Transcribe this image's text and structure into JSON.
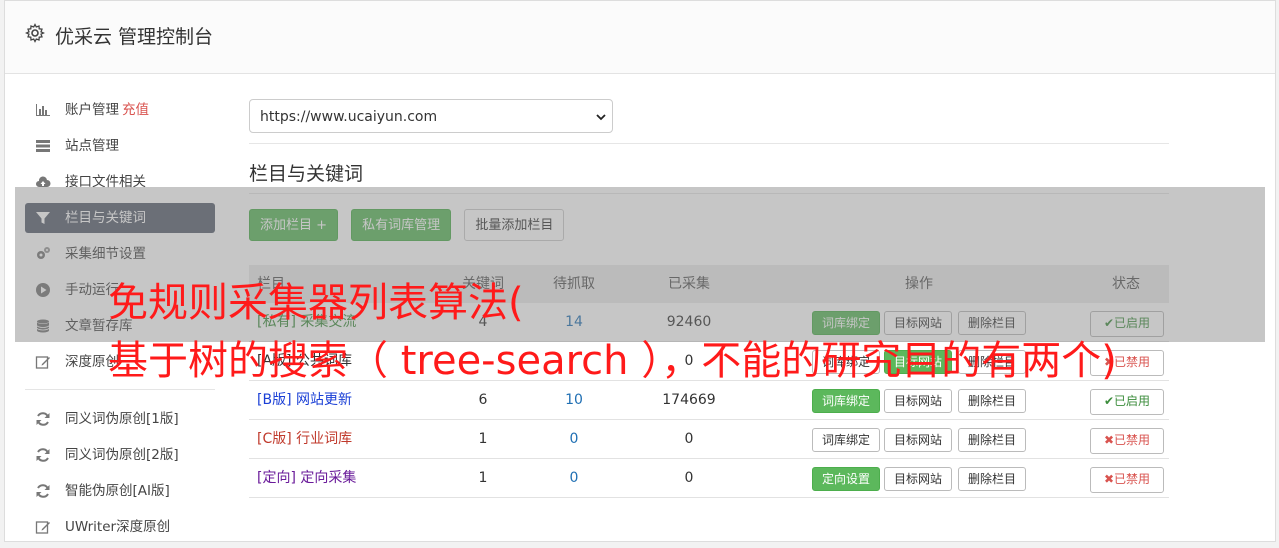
{
  "header": {
    "title": "优采云 管理控制台",
    "icon": "gear-icon"
  },
  "sidebar": {
    "items": [
      {
        "label": "账户管理",
        "extra": "充值",
        "icon": "bar-chart-icon"
      },
      {
        "label": "站点管理",
        "icon": "server-icon"
      },
      {
        "label": "接口文件相关",
        "icon": "cloud-upload-icon"
      },
      {
        "label": "栏目与关键词",
        "icon": "filter-icon",
        "active": true
      },
      {
        "label": "采集细节设置",
        "icon": "gears-icon"
      },
      {
        "label": "手动运行",
        "icon": "play-circle-icon"
      },
      {
        "label": "文章暂存库",
        "icon": "database-icon"
      },
      {
        "label": "深度原创",
        "icon": "edit-icon"
      }
    ],
    "items2": [
      {
        "label": "同义词伪原创[1版]",
        "icon": "refresh-icon"
      },
      {
        "label": "同义词伪原创[2版]",
        "icon": "refresh-icon"
      },
      {
        "label": "智能伪原创[AI版]",
        "icon": "refresh-icon"
      },
      {
        "label": "UWriter深度原创",
        "icon": "edit-icon"
      }
    ]
  },
  "main": {
    "site_select": "https://www.ucaiyun.com",
    "section_title": "栏目与关键词",
    "buttons": {
      "add": "添加栏目 +",
      "private_lib": "私有词库管理",
      "batch_add": "批量添加栏目"
    },
    "table": {
      "headers": {
        "name": "栏目",
        "keywords": "关键词",
        "pending": "待抓取",
        "collected": "已采集",
        "ops": "操作",
        "status": "状态"
      },
      "rows": [
        {
          "name": "[私有] 采集交流",
          "keywords": "4",
          "pending": "14",
          "collected": "92460",
          "op1": "词库绑定",
          "op2": "目标网站",
          "op3": "删除栏目",
          "status": "已启用",
          "op1_green": true,
          "on": true
        },
        {
          "name": "[A版] 公共词库",
          "keywords": "",
          "pending": "",
          "collected": "0",
          "op1": "词库绑定",
          "op2": "目标网站",
          "op3": "删除栏目",
          "status": "已禁用",
          "op1_green": false,
          "on": false
        },
        {
          "name": "[B版] 网站更新",
          "keywords": "6",
          "pending": "10",
          "collected": "174669",
          "op1": "词库绑定",
          "op2": "目标网站",
          "op3": "删除栏目",
          "status": "已启用",
          "op1_green": true,
          "on": true
        },
        {
          "name": "[C版] 行业词库",
          "keywords": "1",
          "pending": "0",
          "collected": "0",
          "op1": "词库绑定",
          "op2": "目标网站",
          "op3": "删除栏目",
          "status": "已禁用",
          "op1_green": false,
          "on": false
        },
        {
          "name": "[定向] 定向采集",
          "keywords": "1",
          "pending": "0",
          "collected": "0",
          "op1": "定向设置",
          "op2": "目标网站",
          "op3": "删除栏目",
          "status": "已禁用",
          "op1_green": true,
          "on": false
        }
      ]
    }
  },
  "overlay": {
    "line1": "免规则采集器列表算法(",
    "line2": "基于树的搜索（ tree-search ），不能的研究目的有两个)"
  },
  "colors": {
    "green": "#5cb85c",
    "red": "#d9534f",
    "active_nav": "#5a6170",
    "overlay_text": "#ff1a1a"
  }
}
